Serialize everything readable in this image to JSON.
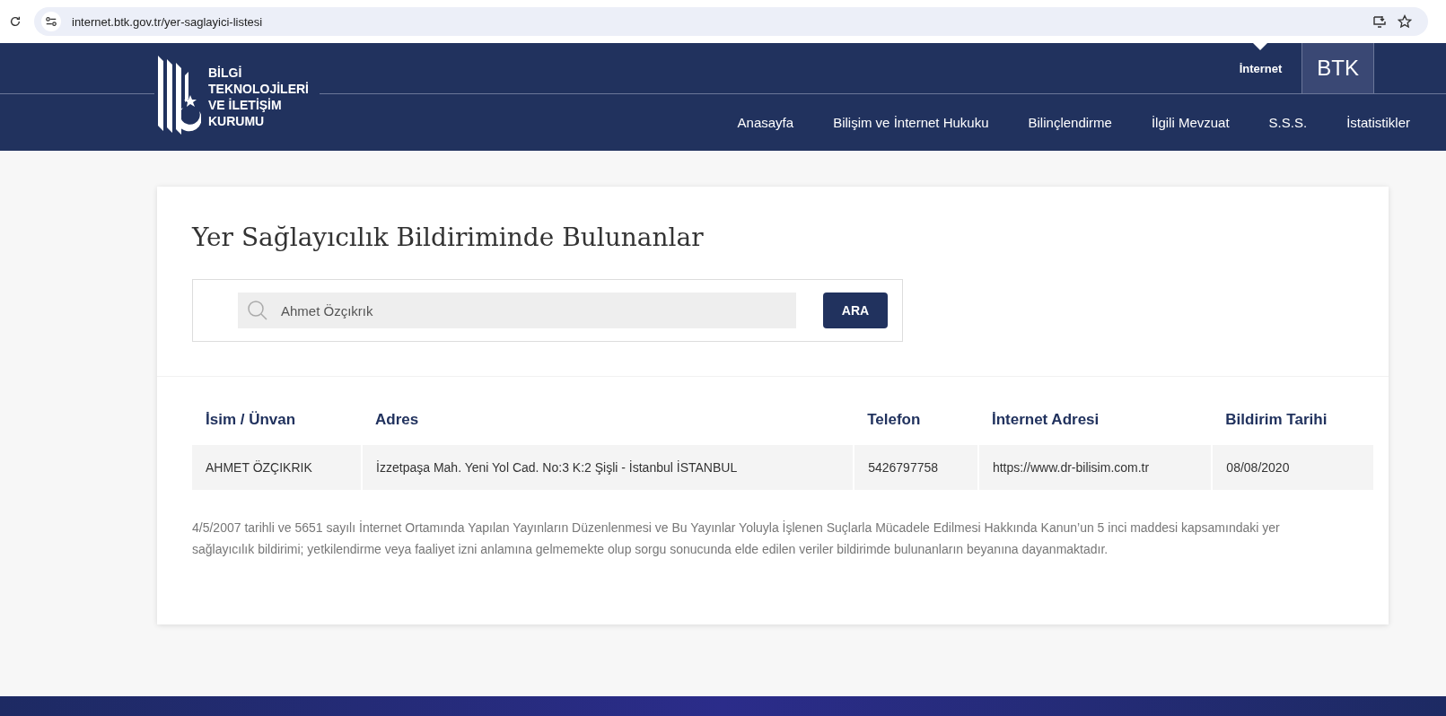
{
  "browser": {
    "url": "internet.btk.gov.tr/yer-saglayici-listesi"
  },
  "header": {
    "logo_lines": [
      "BİLGİ",
      "TEKNOLOJİLERİ",
      "VE İLETİŞİM",
      "KURUMU"
    ],
    "top_links": [
      {
        "label": "İnternet",
        "selected": true
      }
    ],
    "brand_button": "BTK",
    "nav": [
      "Anasayfa",
      "Bilişim ve İnternet Hukuku",
      "Bilinçlendirme",
      "İlgili Mevzuat",
      "S.S.S.",
      "İstatistikler"
    ]
  },
  "page": {
    "title": "Yer Sağlayıcılık Bildiriminde Bulunanlar",
    "search": {
      "value": "Ahmet Özçıkrık",
      "button": "ARA"
    },
    "table": {
      "columns": [
        "İsim / Ünvan",
        "Adres",
        "Telefon",
        "İnternet Adresi",
        "Bildirim Tarihi"
      ],
      "rows": [
        [
          "AHMET ÖZÇIKRIK",
          "İzzetpaşa Mah. Yeni Yol Cad. No:3 K:2 Şişli - İstanbul İSTANBUL",
          "5426797758",
          "https://www.dr-bilisim.com.tr",
          "08/08/2020"
        ]
      ]
    },
    "note": "4/5/2007 tarihli ve 5651 sayılı İnternet Ortamında Yapılan Yayınların Düzenlenmesi ve Bu Yayınlar Yoluyla İşlenen Suçlarla Mücadele Edilmesi Hakkında Kanun’un 5 inci maddesi kapsamındaki yer sağlayıcılık bildirimi; yetkilendirme veya faaliyet izni anlamına gelmemekte olup sorgu sonucunda elde edilen veriler bildirimde bulunanların beyanına dayanmaktadır."
  }
}
